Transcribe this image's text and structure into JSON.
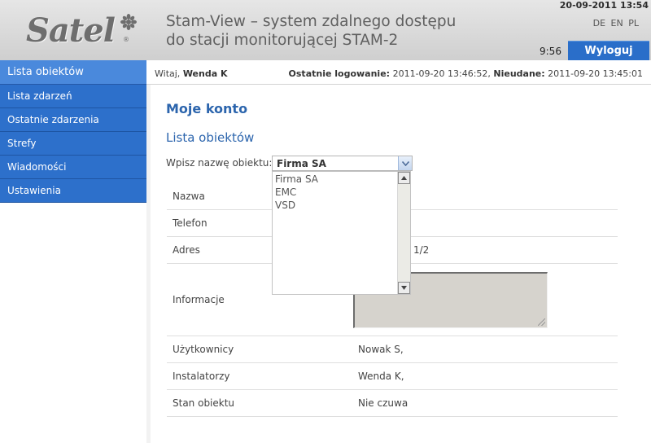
{
  "header": {
    "logo_text": "Satel",
    "title_line1": "Stam-View – system zdalnego dostępu",
    "title_line2": "do stacji monitorującej STAM-2",
    "datetime": "20-09-2011 13:54",
    "languages": [
      "DE",
      "EN",
      "PL"
    ],
    "clock": "9:56",
    "logout_label": "Wyloguj"
  },
  "session": {
    "welcome_prefix": "Witaj,",
    "user_name": "Wenda K",
    "last_login_label": "Ostatnie logowanie:",
    "last_login_value": "2011-09-20 13:46:52,",
    "failed_label": "Nieudane:",
    "failed_value": "2011-09-20 13:45:01"
  },
  "sidebar": {
    "items": [
      {
        "label": "Lista obiektów",
        "active": true
      },
      {
        "label": "Lista zdarzeń"
      },
      {
        "label": "Ostatnie zdarzenia"
      },
      {
        "label": "Strefy"
      },
      {
        "label": "Wiadomości"
      },
      {
        "label": "Ustawienia"
      }
    ]
  },
  "main": {
    "heading": "Moje konto",
    "subheading": "Lista obiektów",
    "search_label": "Wpisz nazwę obiektu:",
    "combo_value": "Firma SA",
    "dropdown_options": [
      "Firma SA",
      "EMC",
      "VSD"
    ],
    "fields": [
      {
        "label": "Nazwa",
        "value": ""
      },
      {
        "label": "Telefon",
        "value": ""
      },
      {
        "label": "Adres",
        "value": "1/2"
      },
      {
        "label": "Informacje",
        "value": ""
      },
      {
        "label": "Użytkownicy",
        "value": "Nowak S,"
      },
      {
        "label": "Instalatorzy",
        "value": "Wenda K,"
      },
      {
        "label": "Stan obiektu",
        "value": "Nie czuwa"
      }
    ]
  },
  "colors": {
    "nav_blue": "#2d70cb",
    "nav_active": "#4a89dc",
    "heading_blue": "#2c65ad",
    "logout_blue": "#2a6ec9"
  }
}
